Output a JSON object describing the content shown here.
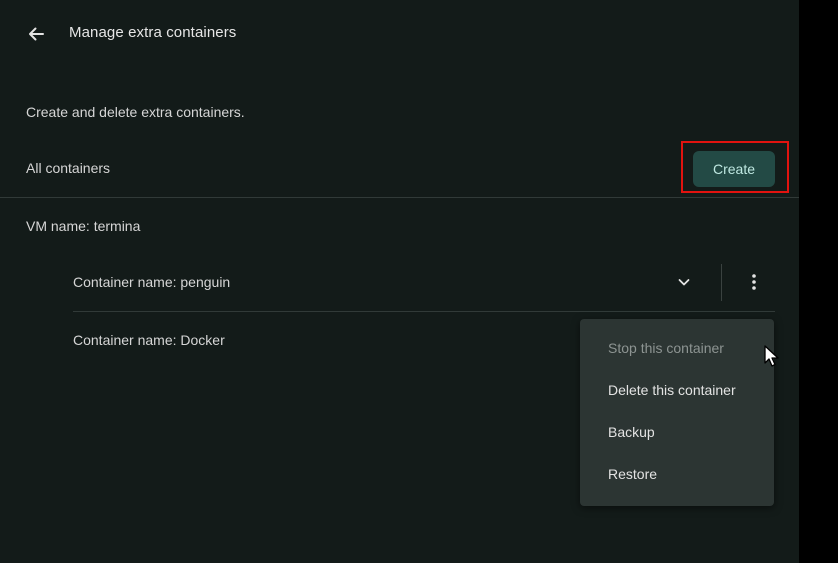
{
  "header": {
    "back_icon": "arrow-left-icon",
    "title": "Manage extra containers"
  },
  "main": {
    "description": "Create and delete extra containers.",
    "section_label": "All containers",
    "create_label": "Create",
    "vm": {
      "label": "VM name: termina",
      "containers": [
        {
          "label": "Container name: penguin",
          "icons": [
            "chevron-down-icon",
            "more-vertical-icon"
          ]
        },
        {
          "label": "Container name: Docker"
        }
      ]
    }
  },
  "context_menu": {
    "items": [
      {
        "label": "Stop this container",
        "disabled": true
      },
      {
        "label": "Delete this container",
        "disabled": false
      },
      {
        "label": "Backup",
        "disabled": false
      },
      {
        "label": "Restore",
        "disabled": false
      }
    ]
  },
  "colors": {
    "background": "#131b19",
    "accent_button": "#234a45",
    "accent_text": "#bfe8e1",
    "highlight": "#e2130f",
    "menu_background": "#2c3533"
  }
}
